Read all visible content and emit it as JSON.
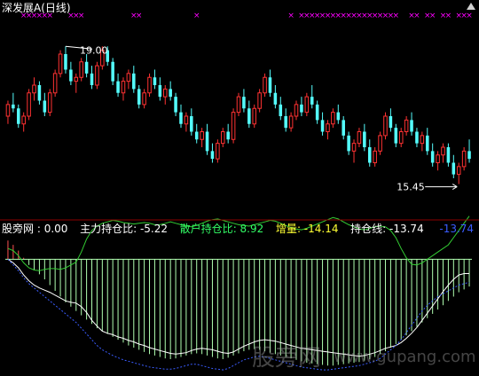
{
  "header_top": {
    "stock_name": "深发展A",
    "period": "(日线)",
    "tools_icon": "settings-icon"
  },
  "indicator_header": {
    "name": "股旁网",
    "name_value": ": 0.00",
    "zlccb": {
      "label": "主力持仓比",
      "value": "-5.22"
    },
    "shccb": {
      "label": "散户持仓比",
      "value": "8.92"
    },
    "zl": {
      "label": "增量",
      "value": "-14.14"
    },
    "ccx": {
      "label": "持仓线",
      "value": "-13.74"
    },
    "tail_value": "-13.74"
  },
  "watermark": {
    "text_cn": "股旁网",
    "text_url": "www.gupang.com"
  },
  "colors": {
    "up": "#ff3232",
    "down": "#54fcfc",
    "marker": "#ff00ff",
    "green_line": "#33cc33",
    "white_line": "#ffffff",
    "hist_pos": "#ff5050",
    "hist_neg": "#b0ffb0",
    "blue": "#3a5cff",
    "header_white": "#ffffff",
    "header_green": "#33ff66",
    "header_yellow": "#ffff33"
  },
  "chart_data": [
    {
      "type": "candlestick",
      "title": "深发展A (日线)",
      "ylim": [
        14.8,
        19.6
      ],
      "annotations": [
        {
          "label": "19.00",
          "kind": "high",
          "value": 19.0
        },
        {
          "label": "15.45",
          "kind": "low",
          "value": 15.45
        }
      ],
      "candles": [
        [
          17.2,
          17.6,
          17.0,
          17.5
        ],
        [
          17.5,
          17.8,
          17.3,
          17.4
        ],
        [
          17.4,
          17.5,
          16.9,
          17.0
        ],
        [
          17.0,
          17.3,
          16.8,
          17.2
        ],
        [
          17.2,
          17.9,
          17.1,
          17.8
        ],
        [
          17.8,
          18.2,
          17.6,
          18.0
        ],
        [
          18.0,
          18.1,
          17.5,
          17.6
        ],
        [
          17.6,
          17.8,
          17.2,
          17.3
        ],
        [
          17.3,
          17.9,
          17.2,
          17.8
        ],
        [
          17.8,
          18.4,
          17.7,
          18.3
        ],
        [
          18.3,
          18.9,
          18.2,
          18.8
        ],
        [
          18.8,
          19.0,
          18.3,
          18.4
        ],
        [
          18.4,
          18.6,
          18.0,
          18.1
        ],
        [
          18.1,
          18.3,
          17.8,
          18.2
        ],
        [
          18.2,
          18.7,
          18.1,
          18.6
        ],
        [
          18.6,
          18.8,
          18.2,
          18.3
        ],
        [
          18.3,
          18.5,
          17.9,
          18.0
        ],
        [
          18.0,
          18.6,
          17.9,
          18.5
        ],
        [
          18.5,
          19.0,
          18.4,
          18.9
        ],
        [
          18.9,
          19.0,
          18.5,
          18.6
        ],
        [
          18.6,
          18.7,
          18.0,
          18.1
        ],
        [
          18.1,
          18.3,
          17.7,
          17.8
        ],
        [
          17.8,
          18.2,
          17.6,
          18.1
        ],
        [
          18.1,
          18.4,
          17.9,
          18.3
        ],
        [
          18.3,
          18.5,
          17.8,
          17.9
        ],
        [
          17.9,
          18.0,
          17.4,
          17.5
        ],
        [
          17.5,
          17.9,
          17.4,
          17.8
        ],
        [
          17.8,
          18.3,
          17.7,
          18.2
        ],
        [
          18.2,
          18.4,
          17.9,
          18.0
        ],
        [
          18.0,
          18.2,
          17.6,
          17.7
        ],
        [
          17.7,
          18.0,
          17.5,
          17.9
        ],
        [
          17.9,
          18.1,
          17.6,
          17.7
        ],
        [
          17.7,
          17.8,
          17.2,
          17.3
        ],
        [
          17.3,
          17.5,
          16.9,
          17.0
        ],
        [
          17.0,
          17.3,
          16.8,
          17.2
        ],
        [
          17.2,
          17.4,
          16.7,
          16.8
        ],
        [
          16.8,
          17.0,
          16.5,
          16.6
        ],
        [
          16.6,
          16.9,
          16.4,
          16.8
        ],
        [
          16.8,
          17.0,
          16.2,
          16.3
        ],
        [
          16.3,
          16.5,
          16.0,
          16.1
        ],
        [
          16.1,
          16.6,
          16.0,
          16.5
        ],
        [
          16.5,
          16.9,
          16.4,
          16.8
        ],
        [
          16.8,
          17.0,
          16.5,
          16.6
        ],
        [
          16.6,
          17.4,
          16.5,
          17.3
        ],
        [
          17.3,
          17.8,
          17.2,
          17.7
        ],
        [
          17.7,
          17.9,
          17.3,
          17.4
        ],
        [
          17.4,
          17.6,
          16.9,
          17.0
        ],
        [
          17.0,
          17.5,
          16.9,
          17.4
        ],
        [
          17.4,
          17.9,
          17.3,
          17.8
        ],
        [
          17.8,
          18.3,
          17.7,
          18.2
        ],
        [
          18.2,
          18.4,
          17.7,
          17.8
        ],
        [
          17.8,
          18.0,
          17.4,
          17.5
        ],
        [
          17.5,
          17.7,
          17.1,
          17.2
        ],
        [
          17.2,
          17.4,
          16.8,
          16.9
        ],
        [
          16.9,
          17.3,
          16.8,
          17.2
        ],
        [
          17.2,
          17.6,
          17.1,
          17.5
        ],
        [
          17.5,
          17.7,
          17.2,
          17.3
        ],
        [
          17.3,
          17.8,
          17.2,
          17.7
        ],
        [
          17.7,
          18.0,
          17.4,
          17.5
        ],
        [
          17.5,
          17.6,
          17.0,
          17.1
        ],
        [
          17.1,
          17.3,
          16.7,
          16.8
        ],
        [
          16.8,
          17.1,
          16.6,
          17.0
        ],
        [
          17.0,
          17.4,
          16.9,
          17.3
        ],
        [
          17.3,
          17.5,
          17.0,
          17.1
        ],
        [
          17.1,
          17.2,
          16.6,
          16.7
        ],
        [
          16.7,
          16.8,
          16.2,
          16.3
        ],
        [
          16.3,
          16.6,
          16.0,
          16.5
        ],
        [
          16.5,
          16.9,
          16.4,
          16.8
        ],
        [
          16.8,
          17.0,
          16.3,
          16.4
        ],
        [
          16.4,
          16.6,
          15.9,
          16.0
        ],
        [
          16.0,
          16.4,
          15.9,
          16.3
        ],
        [
          16.3,
          16.8,
          16.2,
          16.7
        ],
        [
          16.7,
          17.3,
          16.6,
          17.2
        ],
        [
          17.2,
          17.4,
          16.8,
          16.9
        ],
        [
          16.9,
          17.0,
          16.4,
          16.5
        ],
        [
          16.5,
          16.9,
          16.4,
          16.8
        ],
        [
          16.8,
          17.2,
          16.7,
          17.1
        ],
        [
          17.1,
          17.3,
          16.7,
          16.8
        ],
        [
          16.8,
          16.9,
          16.4,
          16.5
        ],
        [
          16.5,
          16.8,
          16.3,
          16.7
        ],
        [
          16.7,
          16.9,
          16.2,
          16.3
        ],
        [
          16.3,
          16.5,
          15.9,
          16.0
        ],
        [
          16.0,
          16.3,
          15.8,
          16.2
        ],
        [
          16.2,
          16.5,
          16.0,
          16.4
        ],
        [
          16.4,
          16.5,
          15.9,
          16.0
        ],
        [
          16.0,
          16.2,
          15.6,
          15.7
        ],
        [
          15.7,
          16.0,
          15.45,
          15.9
        ],
        [
          15.9,
          16.4,
          15.8,
          16.3
        ],
        [
          16.3,
          16.6,
          16.0,
          16.1
        ]
      ]
    },
    {
      "type": "line",
      "title": "股旁网",
      "ylim": [
        -16,
        3
      ],
      "series": [
        {
          "name": "散户持仓比",
          "color_key": "green_line",
          "values": [
            1.5,
            1.2,
            0.5,
            -0.5,
            -1.2,
            -1.5,
            -1.6,
            -1.4,
            -1.3,
            -1.3,
            -1.4,
            -1.2,
            -0.8,
            -0.4,
            1.0,
            2.8,
            4.0,
            4.6,
            5.0,
            5.2,
            5.4,
            5.3,
            5.1,
            5.0,
            4.9,
            5.0,
            5.1,
            5.0,
            4.8,
            4.8,
            5.0,
            5.2,
            5.0,
            4.8,
            4.6,
            4.5,
            4.7,
            5.0,
            5.3,
            5.5,
            5.6,
            5.4,
            5.2,
            5.0,
            4.8,
            4.7,
            4.6,
            4.8,
            5.0,
            5.2,
            5.4,
            5.3,
            5.0,
            4.7,
            4.4,
            4.2,
            4.1,
            4.3,
            4.6,
            4.9,
            5.2,
            5.5,
            5.8,
            5.6,
            5.2,
            4.8,
            4.5,
            4.2,
            4.1,
            4.3,
            4.5,
            4.6,
            4.5,
            4.0,
            3.0,
            1.5,
            0.2,
            -0.7,
            -0.8,
            -0.5,
            0.0,
            0.5,
            1.0,
            1.5,
            2.0,
            3.0,
            4.0,
            5.0,
            6.0
          ]
        },
        {
          "name": "持仓线",
          "color_key": "white_line",
          "values": [
            0.0,
            -0.5,
            -1.2,
            -2.2,
            -3.0,
            -3.6,
            -4.0,
            -4.3,
            -4.6,
            -5.0,
            -5.4,
            -5.8,
            -6.0,
            -6.1,
            -6.6,
            -7.4,
            -8.5,
            -9.3,
            -10.0,
            -10.3,
            -10.5,
            -10.8,
            -11.0,
            -11.3,
            -11.5,
            -11.8,
            -12.0,
            -12.3,
            -12.5,
            -12.7,
            -12.9,
            -13.1,
            -13.2,
            -13.1,
            -13.0,
            -12.7,
            -12.5,
            -12.4,
            -12.5,
            -12.6,
            -12.8,
            -13.0,
            -13.1,
            -12.9,
            -12.5,
            -12.1,
            -11.8,
            -11.5,
            -11.3,
            -11.2,
            -11.3,
            -11.4,
            -11.6,
            -11.8,
            -12.0,
            -12.2,
            -12.4,
            -12.5,
            -12.6,
            -12.7,
            -12.8,
            -12.9,
            -13.0,
            -13.1,
            -13.2,
            -13.3,
            -13.4,
            -13.5,
            -13.4,
            -13.2,
            -13.0,
            -12.7,
            -12.4,
            -12.2,
            -12.0,
            -11.6,
            -11.0,
            -10.3,
            -9.5,
            -8.5,
            -7.5,
            -6.5,
            -5.5,
            -4.5,
            -3.6,
            -2.8,
            -2.2,
            -2.0,
            -2.0
          ]
        },
        {
          "name": "增量",
          "color_key": "blue",
          "style": "dotted",
          "values": [
            0.0,
            -0.8,
            -1.6,
            -2.6,
            -3.4,
            -4.0,
            -4.6,
            -5.2,
            -5.8,
            -6.4,
            -7.0,
            -7.6,
            -8.2,
            -8.8,
            -9.6,
            -10.4,
            -11.2,
            -12.0,
            -12.6,
            -13.0,
            -13.4,
            -13.7,
            -14.0,
            -14.2,
            -14.4,
            -14.6,
            -14.8,
            -15.0,
            -15.1,
            -15.2,
            -15.3,
            -15.3,
            -15.2,
            -15.0,
            -14.8,
            -14.6,
            -14.6,
            -14.8,
            -15.0,
            -15.2,
            -15.3,
            -15.4,
            -15.2,
            -14.8,
            -14.4,
            -14.0,
            -13.8,
            -13.6,
            -13.5,
            -13.6,
            -13.8,
            -14.0,
            -14.2,
            -14.4,
            -14.6,
            -14.8,
            -15.0,
            -15.1,
            -15.2,
            -15.3,
            -15.4,
            -15.4,
            -15.3,
            -15.2,
            -15.1,
            -15.0,
            -14.9,
            -14.8,
            -14.6,
            -14.4,
            -14.2,
            -13.8,
            -13.2,
            -12.6,
            -12.0,
            -11.2,
            -10.2,
            -9.2,
            -8.2,
            -7.2,
            -6.4,
            -5.8,
            -5.2,
            -4.8,
            -4.4,
            -4.0,
            -3.6,
            -3.4,
            -3.2
          ]
        }
      ],
      "histogram": {
        "name": "主力持仓比",
        "values": [
          2.6,
          2.0,
          1.2,
          0.2,
          -0.8,
          -1.5,
          -2.1,
          -2.8,
          -3.6,
          -4.4,
          -5.2,
          -6.0,
          -6.6,
          -7.2,
          -7.8,
          -8.4,
          -9.0,
          -9.6,
          -10.0,
          -10.4,
          -10.8,
          -11.2,
          -11.6,
          -12.0,
          -12.3,
          -12.6,
          -12.9,
          -13.2,
          -13.4,
          -13.6,
          -13.8,
          -13.9,
          -13.8,
          -13.6,
          -13.4,
          -13.2,
          -13.1,
          -13.2,
          -13.4,
          -13.6,
          -13.8,
          -13.9,
          -13.7,
          -13.4,
          -13.1,
          -12.8,
          -12.6,
          -12.5,
          -12.6,
          -12.8,
          -13.0,
          -13.2,
          -13.4,
          -13.6,
          -13.8,
          -14.0,
          -14.2,
          -14.4,
          -14.5,
          -14.6,
          -14.7,
          -14.8,
          -14.8,
          -14.7,
          -14.6,
          -14.5,
          -14.4,
          -14.3,
          -14.1,
          -13.9,
          -13.6,
          -13.2,
          -12.8,
          -12.3,
          -11.8,
          -11.2,
          -10.6,
          -10.0,
          -9.4,
          -8.8,
          -8.2,
          -7.6,
          -7.0,
          -6.4,
          -5.8,
          -5.2,
          -4.6,
          -4.2,
          -3.8
        ]
      }
    }
  ]
}
